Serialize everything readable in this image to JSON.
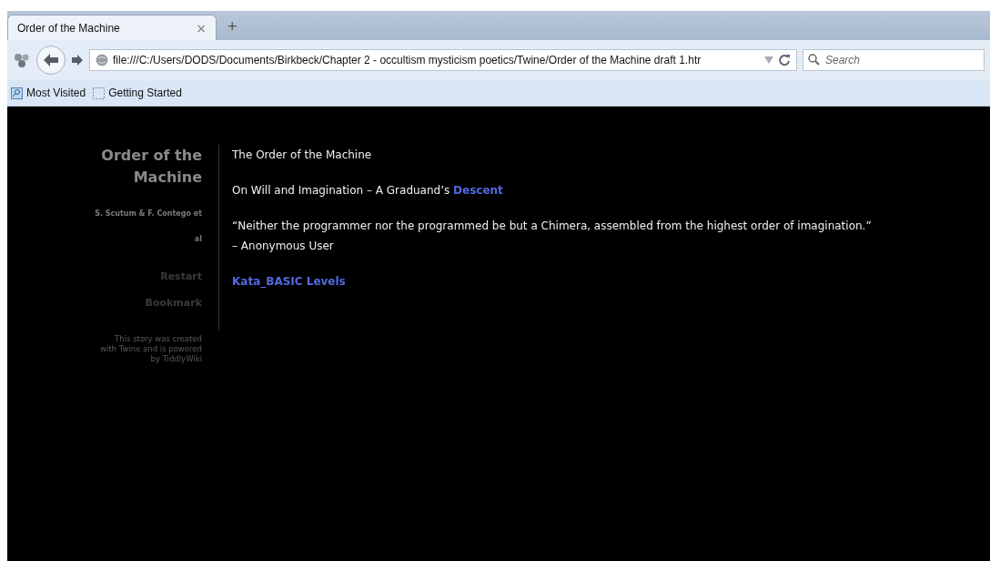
{
  "browser": {
    "tabs": [
      {
        "title": "Order of the Machine",
        "close": "×",
        "selected": true
      }
    ],
    "new_tab": "+",
    "address": "file:///C:/Users/DODS/Documents/Birkbeck/Chapter 2 - occultism mysticism poetics/Twine/Order of the Machine draft 1.htr",
    "search_placeholder": "Search",
    "bookmarks": [
      "Most Visited",
      "Getting Started"
    ]
  },
  "sidebar": {
    "title": "Order of the Machine",
    "author_lines": [
      "S. Scutum & F. Contego et",
      "al"
    ],
    "menu": [
      "Restart",
      "Bookmark"
    ],
    "credit_lines": [
      "This story was created",
      "with Twine and is powered",
      "by TiddlyWiki"
    ]
  },
  "passage": {
    "paragraphs": [
      {
        "lines": [
          "The Order of the Machine"
        ]
      },
      {
        "lines": [
          "On Will and Imagination – A Graduand’s "
        ],
        "link": "Descent"
      },
      {
        "lines": [
          "“Neither the programmer nor the programmed be but a Chimera, assembled from the highest order of imagination.”",
          "– Anonymous User"
        ]
      },
      {
        "link": "Kata_BASIC Levels"
      }
    ]
  }
}
